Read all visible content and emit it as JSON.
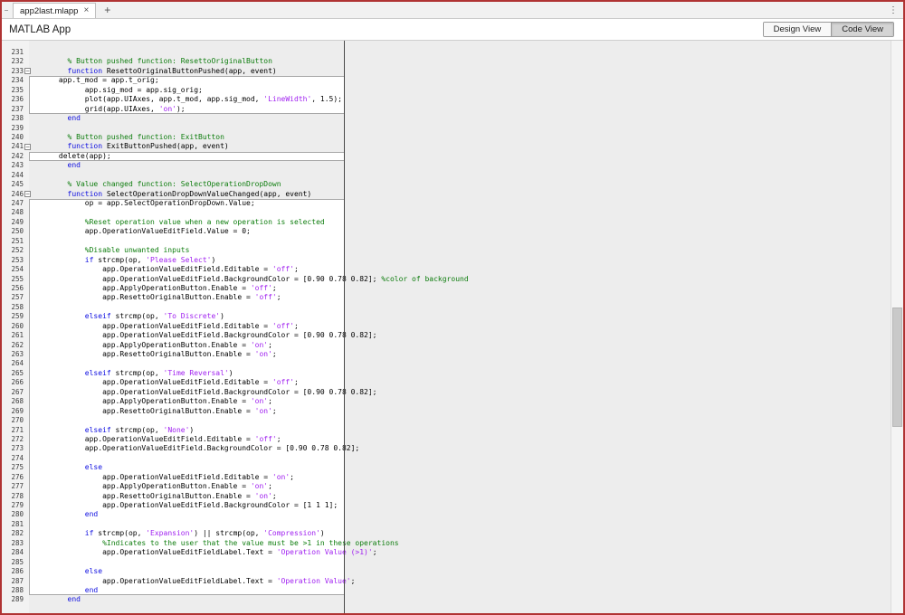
{
  "colors": {
    "frame": "#b03333",
    "keyword": "#0d0de0",
    "comment": "#0e7d0e",
    "string": "#a020f0",
    "plain": "#000000",
    "guide": "#4a4a4a",
    "editable_bg": "#ffffff",
    "readonly_bg": "#ededed",
    "gutter_bg": "#f2f2f2",
    "box_border": "#a8a8a8",
    "scroll_thumb": "#c9c9c9"
  },
  "tab_bar": {
    "dock_glyph": "−",
    "tabs": [
      {
        "label": "app2last.mlapp",
        "close_glyph": "×",
        "active": true
      }
    ],
    "new_tab_glyph": "+",
    "overflow_glyph": "⋮"
  },
  "toolbar": {
    "app_label": "MATLAB App",
    "design_view": "Design View",
    "code_view": "Code View",
    "selected_view": "Code View"
  },
  "editor": {
    "fold_glyph": "−",
    "first_line": 231,
    "last_line": 289,
    "lines": [
      {
        "n": "231",
        "bg": "g",
        "seg": []
      },
      {
        "n": "232",
        "bg": "g",
        "seg": [
          [
            "t",
            "        "
          ],
          [
            "c",
            "% Button pushed function: ResettoOriginalButton"
          ]
        ]
      },
      {
        "n": "233",
        "bg": "g",
        "fold": true,
        "seg": [
          [
            "t",
            "        "
          ],
          [
            "k",
            "function"
          ],
          [
            "t",
            " ResettoOriginalButtonPushed(app, event)"
          ]
        ]
      },
      {
        "n": "234",
        "bg": "w",
        "seg": [
          [
            "t",
            "      app.t_mod = app.t_orig;"
          ]
        ]
      },
      {
        "n": "235",
        "bg": "w",
        "seg": [
          [
            "t",
            "            app.sig_mod = app.sig_orig;"
          ]
        ]
      },
      {
        "n": "236",
        "bg": "w",
        "seg": [
          [
            "t",
            "            plot(app.UIAxes, app.t_mod, app.sig_mod, "
          ],
          [
            "s",
            "'LineWidth'"
          ],
          [
            "t",
            ", 1.5);"
          ]
        ]
      },
      {
        "n": "237",
        "bg": "w",
        "seg": [
          [
            "t",
            "            grid(app.UIAxes, "
          ],
          [
            "s",
            "'on'"
          ],
          [
            "t",
            ");"
          ]
        ]
      },
      {
        "n": "238",
        "bg": "g",
        "seg": [
          [
            "t",
            "        "
          ],
          [
            "k",
            "end"
          ]
        ]
      },
      {
        "n": "239",
        "bg": "g",
        "seg": []
      },
      {
        "n": "240",
        "bg": "g",
        "seg": [
          [
            "t",
            "        "
          ],
          [
            "c",
            "% Button pushed function: ExitButton"
          ]
        ]
      },
      {
        "n": "241",
        "bg": "g",
        "fold": true,
        "seg": [
          [
            "t",
            "        "
          ],
          [
            "k",
            "function"
          ],
          [
            "t",
            " ExitButtonPushed(app, event)"
          ]
        ]
      },
      {
        "n": "242",
        "bg": "w",
        "seg": [
          [
            "t",
            "      delete(app);"
          ]
        ]
      },
      {
        "n": "243",
        "bg": "g",
        "seg": [
          [
            "t",
            "        "
          ],
          [
            "k",
            "end"
          ]
        ]
      },
      {
        "n": "244",
        "bg": "g",
        "seg": []
      },
      {
        "n": "245",
        "bg": "g",
        "seg": [
          [
            "t",
            "        "
          ],
          [
            "c",
            "% Value changed function: SelectOperationDropDown"
          ]
        ]
      },
      {
        "n": "246",
        "bg": "g",
        "fold": true,
        "seg": [
          [
            "t",
            "        "
          ],
          [
            "k",
            "function"
          ],
          [
            "t",
            " SelectOperationDropDownValueChanged(app, event)"
          ]
        ]
      },
      {
        "n": "247",
        "bg": "w",
        "seg": [
          [
            "t",
            "            op = app.SelectOperationDropDown.Value;"
          ]
        ]
      },
      {
        "n": "248",
        "bg": "w",
        "seg": []
      },
      {
        "n": "249",
        "bg": "w",
        "seg": [
          [
            "t",
            "            "
          ],
          [
            "c",
            "%Reset operation value when a new operation is selected"
          ]
        ]
      },
      {
        "n": "250",
        "bg": "w",
        "seg": [
          [
            "t",
            "            app.OperationValueEditField.Value = 0;"
          ]
        ]
      },
      {
        "n": "251",
        "bg": "w",
        "seg": []
      },
      {
        "n": "252",
        "bg": "w",
        "seg": [
          [
            "t",
            "            "
          ],
          [
            "c",
            "%Disable unwanted inputs"
          ]
        ]
      },
      {
        "n": "253",
        "bg": "w",
        "seg": [
          [
            "t",
            "            "
          ],
          [
            "k",
            "if"
          ],
          [
            "t",
            " strcmp(op, "
          ],
          [
            "s",
            "'Please Select'"
          ],
          [
            "t",
            ")"
          ]
        ]
      },
      {
        "n": "254",
        "bg": "w",
        "seg": [
          [
            "t",
            "                app.OperationValueEditField.Editable = "
          ],
          [
            "s",
            "'off'"
          ],
          [
            "t",
            ";"
          ]
        ]
      },
      {
        "n": "255",
        "bg": "w",
        "seg": [
          [
            "t",
            "                app.OperationValueEditField.BackgroundColor = [0.90 0.78 0.82]; "
          ],
          [
            "c",
            "%color of background"
          ]
        ]
      },
      {
        "n": "256",
        "bg": "w",
        "seg": [
          [
            "t",
            "                app.ApplyOperationButton.Enable = "
          ],
          [
            "s",
            "'off'"
          ],
          [
            "t",
            ";"
          ]
        ]
      },
      {
        "n": "257",
        "bg": "w",
        "seg": [
          [
            "t",
            "                app.ResettoOriginalButton.Enable = "
          ],
          [
            "s",
            "'off'"
          ],
          [
            "t",
            ";"
          ]
        ]
      },
      {
        "n": "258",
        "bg": "w",
        "seg": []
      },
      {
        "n": "259",
        "bg": "w",
        "seg": [
          [
            "t",
            "            "
          ],
          [
            "k",
            "elseif"
          ],
          [
            "t",
            " strcmp(op, "
          ],
          [
            "s",
            "'To Discrete'"
          ],
          [
            "t",
            ")"
          ]
        ]
      },
      {
        "n": "260",
        "bg": "w",
        "seg": [
          [
            "t",
            "                app.OperationValueEditField.Editable = "
          ],
          [
            "s",
            "'off'"
          ],
          [
            "t",
            ";"
          ]
        ]
      },
      {
        "n": "261",
        "bg": "w",
        "seg": [
          [
            "t",
            "                app.OperationValueEditField.BackgroundColor = [0.90 0.78 0.82];"
          ]
        ]
      },
      {
        "n": "262",
        "bg": "w",
        "seg": [
          [
            "t",
            "                app.ApplyOperationButton.Enable = "
          ],
          [
            "s",
            "'on'"
          ],
          [
            "t",
            ";"
          ]
        ]
      },
      {
        "n": "263",
        "bg": "w",
        "seg": [
          [
            "t",
            "                app.ResettoOriginalButton.Enable = "
          ],
          [
            "s",
            "'on'"
          ],
          [
            "t",
            ";"
          ]
        ]
      },
      {
        "n": "264",
        "bg": "w",
        "seg": []
      },
      {
        "n": "265",
        "bg": "w",
        "seg": [
          [
            "t",
            "            "
          ],
          [
            "k",
            "elseif"
          ],
          [
            "t",
            " strcmp(op, "
          ],
          [
            "s",
            "'Time Reversal'"
          ],
          [
            "t",
            ")"
          ]
        ]
      },
      {
        "n": "266",
        "bg": "w",
        "seg": [
          [
            "t",
            "                app.OperationValueEditField.Editable = "
          ],
          [
            "s",
            "'off'"
          ],
          [
            "t",
            ";"
          ]
        ]
      },
      {
        "n": "267",
        "bg": "w",
        "seg": [
          [
            "t",
            "                app.OperationValueEditField.BackgroundColor = [0.90 0.78 0.82];"
          ]
        ]
      },
      {
        "n": "268",
        "bg": "w",
        "seg": [
          [
            "t",
            "                app.ApplyOperationButton.Enable = "
          ],
          [
            "s",
            "'on'"
          ],
          [
            "t",
            ";"
          ]
        ]
      },
      {
        "n": "269",
        "bg": "w",
        "seg": [
          [
            "t",
            "                app.ResettoOriginalButton.Enable = "
          ],
          [
            "s",
            "'on'"
          ],
          [
            "t",
            ";"
          ]
        ]
      },
      {
        "n": "270",
        "bg": "w",
        "seg": []
      },
      {
        "n": "271",
        "bg": "w",
        "seg": [
          [
            "t",
            "            "
          ],
          [
            "k",
            "elseif"
          ],
          [
            "t",
            " strcmp(op, "
          ],
          [
            "s",
            "'None'"
          ],
          [
            "t",
            ")"
          ]
        ]
      },
      {
        "n": "272",
        "bg": "w",
        "seg": [
          [
            "t",
            "            app.OperationValueEditField.Editable = "
          ],
          [
            "s",
            "'off'"
          ],
          [
            "t",
            ";"
          ]
        ]
      },
      {
        "n": "273",
        "bg": "w",
        "seg": [
          [
            "t",
            "            app.OperationValueEditField.BackgroundColor = [0.90 0.78 0.82];"
          ]
        ]
      },
      {
        "n": "274",
        "bg": "w",
        "seg": []
      },
      {
        "n": "275",
        "bg": "w",
        "seg": [
          [
            "t",
            "            "
          ],
          [
            "k",
            "else"
          ]
        ]
      },
      {
        "n": "276",
        "bg": "w",
        "seg": [
          [
            "t",
            "                app.OperationValueEditField.Editable = "
          ],
          [
            "s",
            "'on'"
          ],
          [
            "t",
            ";"
          ]
        ]
      },
      {
        "n": "277",
        "bg": "w",
        "seg": [
          [
            "t",
            "                app.ApplyOperationButton.Enable = "
          ],
          [
            "s",
            "'on'"
          ],
          [
            "t",
            ";"
          ]
        ]
      },
      {
        "n": "278",
        "bg": "w",
        "seg": [
          [
            "t",
            "                app.ResettoOriginalButton.Enable = "
          ],
          [
            "s",
            "'on'"
          ],
          [
            "t",
            ";"
          ]
        ]
      },
      {
        "n": "279",
        "bg": "w",
        "seg": [
          [
            "t",
            "                app.OperationValueEditField.BackgroundColor = [1 1 1];"
          ]
        ]
      },
      {
        "n": "280",
        "bg": "w",
        "seg": [
          [
            "t",
            "            "
          ],
          [
            "k",
            "end"
          ]
        ]
      },
      {
        "n": "281",
        "bg": "w",
        "seg": []
      },
      {
        "n": "282",
        "bg": "w",
        "seg": [
          [
            "t",
            "            "
          ],
          [
            "k",
            "if"
          ],
          [
            "t",
            " strcmp(op, "
          ],
          [
            "s",
            "'Expansion'"
          ],
          [
            "t",
            ") || strcmp(op, "
          ],
          [
            "s",
            "'Compression'"
          ],
          [
            "t",
            ")"
          ]
        ]
      },
      {
        "n": "283",
        "bg": "w",
        "seg": [
          [
            "t",
            "                "
          ],
          [
            "c",
            "%Indicates to the user that the value must be >1 in these operations"
          ]
        ]
      },
      {
        "n": "284",
        "bg": "w",
        "seg": [
          [
            "t",
            "                app.OperationValueEditFieldLabel.Text = "
          ],
          [
            "s",
            "'Operation Value (>1)'"
          ],
          [
            "t",
            ";"
          ]
        ]
      },
      {
        "n": "285",
        "bg": "w",
        "seg": []
      },
      {
        "n": "286",
        "bg": "w",
        "seg": [
          [
            "t",
            "            "
          ],
          [
            "k",
            "else"
          ]
        ]
      },
      {
        "n": "287",
        "bg": "w",
        "seg": [
          [
            "t",
            "                app.OperationValueEditFieldLabel.Text = "
          ],
          [
            "s",
            "'Operation Value'"
          ],
          [
            "t",
            ";"
          ]
        ]
      },
      {
        "n": "288",
        "bg": "w",
        "seg": [
          [
            "t",
            "            "
          ],
          [
            "k",
            "end"
          ]
        ]
      },
      {
        "n": "289",
        "bg": "g",
        "seg": [
          [
            "t",
            "        "
          ],
          [
            "k",
            "end"
          ]
        ]
      }
    ]
  }
}
